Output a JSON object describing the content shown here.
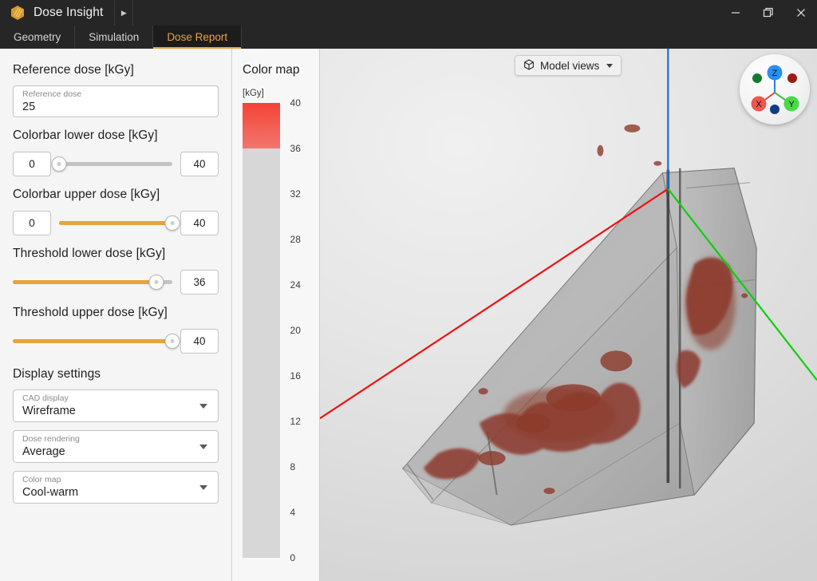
{
  "window": {
    "title": "Dose Insight",
    "logo_icon": "hex-logo-icon",
    "overflow_icon": "chevron-right-icon",
    "minimize_label": "–",
    "maximize_label": "❐",
    "close_label": "✕"
  },
  "tabs": [
    {
      "label": "Geometry",
      "active": false
    },
    {
      "label": "Simulation",
      "active": false
    },
    {
      "label": "Dose Report",
      "active": true
    }
  ],
  "theme": {
    "accent": "#e8a33d",
    "titlebar_bg": "#262626",
    "active_tab_bg": "#1c1c1c",
    "sidebar_bg": "#f5f5f5",
    "hot_color_top": "#f44336",
    "hot_color_bottom": "#f2766e",
    "cold_color": "#d7d7d7"
  },
  "sidebar": {
    "reference_dose": {
      "heading": "Reference dose [kGy]",
      "field_label": "Reference dose",
      "value": "25"
    },
    "colorbar_lower": {
      "heading": "Colorbar lower dose [kGy]",
      "min": "0",
      "max": "40",
      "value": 0,
      "range_min": 0,
      "range_max": 40,
      "filled": false
    },
    "colorbar_upper": {
      "heading": "Colorbar upper dose [kGy]",
      "min": "0",
      "max": "40",
      "value": 40,
      "range_min": 0,
      "range_max": 40,
      "filled": true
    },
    "threshold_lower": {
      "heading": "Threshold lower dose [kGy]",
      "max": "36",
      "value": 36,
      "range_min": 0,
      "range_max": 40,
      "filled": true
    },
    "threshold_upper": {
      "heading": "Threshold upper dose [kGy]",
      "max": "40",
      "value": 40,
      "range_min": 0,
      "range_max": 40,
      "filled": true
    },
    "display_settings": {
      "heading": "Display settings",
      "selects": [
        {
          "label": "CAD display",
          "value": "Wireframe"
        },
        {
          "label": "Dose rendering",
          "value": "Average"
        },
        {
          "label": "Color map",
          "value": "Cool-warm"
        }
      ]
    }
  },
  "colorbar": {
    "title": "Color map",
    "unit": "[kGy]",
    "ticks": [
      40,
      36,
      32,
      28,
      24,
      20,
      16,
      12,
      8,
      4,
      0
    ],
    "scale_min": 0,
    "scale_max": 40,
    "hot_start": 36,
    "hot_end": 40
  },
  "viewport": {
    "model_views_button": "Model views",
    "model_views_icon": "cube-icon",
    "gizmo": {
      "axes": [
        {
          "label": "Z",
          "color": "#2b7fe0"
        },
        {
          "label": "X",
          "color": "#e8473f"
        },
        {
          "label": "Y",
          "color": "#3fbf3f"
        }
      ]
    }
  }
}
